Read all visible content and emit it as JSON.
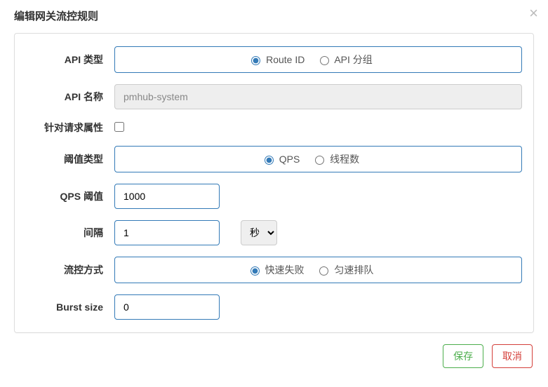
{
  "modal": {
    "title": "编辑网关流控规则"
  },
  "form": {
    "api_type": {
      "label": "API 类型",
      "options": {
        "route_id": "Route ID",
        "api_group": "API 分组"
      },
      "selected": "route_id"
    },
    "api_name": {
      "label": "API 名称",
      "value": "pmhub-system",
      "disabled": true
    },
    "match_attr": {
      "label": "针对请求属性",
      "checked": false
    },
    "threshold_type": {
      "label": "阈值类型",
      "options": {
        "qps": "QPS",
        "threads": "线程数"
      },
      "selected": "qps"
    },
    "qps_threshold": {
      "label": "QPS 阈值",
      "value": "1000"
    },
    "interval": {
      "label": "间隔",
      "value": "1",
      "unit": {
        "options": [
          "秒"
        ],
        "selected": "秒"
      }
    },
    "control_mode": {
      "label": "流控方式",
      "options": {
        "fast_fail": "快速失败",
        "queue": "匀速排队"
      },
      "selected": "fast_fail"
    },
    "burst_size": {
      "label": "Burst size",
      "value": "0"
    }
  },
  "buttons": {
    "save": "保存",
    "cancel": "取消"
  }
}
